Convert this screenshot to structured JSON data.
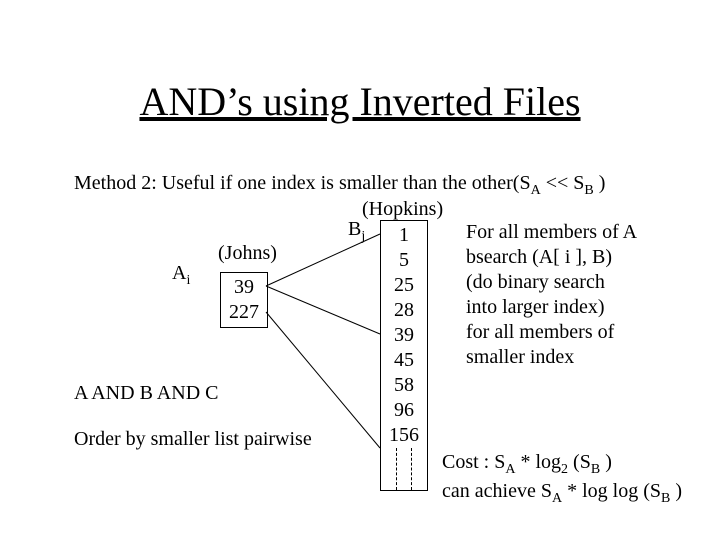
{
  "title": "AND’s using Inverted Files",
  "method_line_pre": "Method 2:  Useful if one index is smaller than the other(S",
  "method_line_subA": "A",
  "method_line_mid": " << S",
  "method_line_subB": "B",
  "method_line_post": " )",
  "hopkins": "(Hopkins)",
  "bj_label_B": "B",
  "bj_label_j": "j",
  "ai_label_A": "A",
  "ai_label_i": "i",
  "johns": "(Johns)",
  "listA": [
    "39",
    "227"
  ],
  "listB": [
    "1",
    "5",
    "25",
    "28",
    "39",
    "45",
    "58",
    "96",
    "156"
  ],
  "a_and_b_c": "A AND B AND C",
  "order_line": "Order by smaller list pairwise",
  "explain": [
    "For all members of A",
    "bsearch (A[ i ], B)",
    "(do binary search",
    "into larger index)",
    "for all members of",
    "smaller index"
  ],
  "cost_pre": "Cost : S",
  "cost_A": "A",
  "cost_mid1": " * log",
  "cost_2": "2",
  "cost_mid2": " (S",
  "cost_B": "B",
  "cost_mid3": " )",
  "cost2_pre": "can achieve S",
  "cost2_A": "A",
  "cost2_mid": " * log log (S",
  "cost2_B": "B",
  "cost2_post": " )"
}
